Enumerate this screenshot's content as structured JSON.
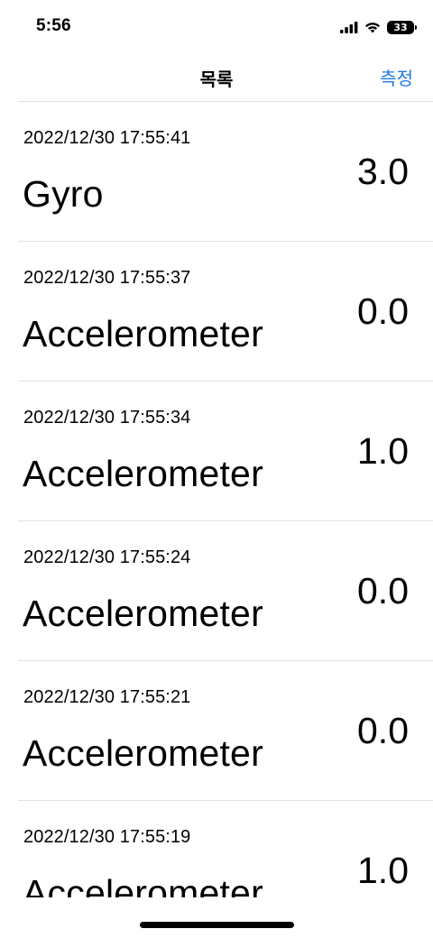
{
  "status_bar": {
    "time": "5:56",
    "battery": "33",
    "icons": [
      "signal-icon",
      "wifi-icon",
      "battery-icon"
    ]
  },
  "nav": {
    "title": "목록",
    "action_label": "측정",
    "action_color": "#1f7ae0"
  },
  "list": {
    "items": [
      {
        "timestamp": "2022/12/30 17:55:41",
        "sensor": "Gyro",
        "value": "3.0"
      },
      {
        "timestamp": "2022/12/30 17:55:37",
        "sensor": "Accelerometer",
        "value": "0.0"
      },
      {
        "timestamp": "2022/12/30 17:55:34",
        "sensor": "Accelerometer",
        "value": "1.0"
      },
      {
        "timestamp": "2022/12/30 17:55:24",
        "sensor": "Accelerometer",
        "value": "0.0"
      },
      {
        "timestamp": "2022/12/30 17:55:21",
        "sensor": "Accelerometer",
        "value": "0.0"
      },
      {
        "timestamp": "2022/12/30 17:55:19",
        "sensor": "Accelerometer",
        "value": "1.0"
      }
    ]
  }
}
